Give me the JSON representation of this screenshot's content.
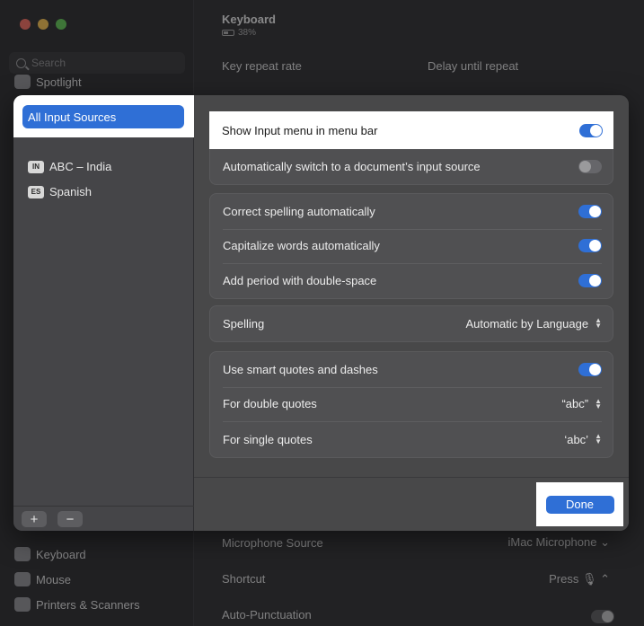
{
  "background": {
    "search_placeholder": "Search",
    "sidebar_items": [
      {
        "label": "Spotlight",
        "icon": "spotlight-icon"
      },
      {
        "label": "Keyboard",
        "icon": "keyboard-icon"
      },
      {
        "label": "Mouse",
        "icon": "mouse-icon"
      },
      {
        "label": "Printers & Scanners",
        "icon": "printer-icon"
      }
    ],
    "title": "Keyboard",
    "battery": "38%",
    "key_repeat_label": "Key repeat rate",
    "delay_label": "Delay until repeat",
    "microphone_label": "Microphone Source",
    "microphone_value": "iMac Microphone",
    "shortcut_label": "Shortcut",
    "shortcut_value": "Press",
    "auto_punct_label": "Auto-Punctuation"
  },
  "sheet": {
    "sidebar": {
      "all_sources": "All Input Sources",
      "sources": [
        {
          "badge": "IN",
          "label": "ABC – India"
        },
        {
          "badge": "ES",
          "label": "Spanish"
        }
      ],
      "add_label": "+",
      "remove_label": "−"
    },
    "main": {
      "show_menu": {
        "label": "Show Input menu in menu bar",
        "on": true
      },
      "auto_switch": {
        "label": "Automatically switch to a document’s input source",
        "on": false
      },
      "correct_spelling": {
        "label": "Correct spelling automatically",
        "on": true
      },
      "capitalize": {
        "label": "Capitalize words automatically",
        "on": true
      },
      "period": {
        "label": "Add period with double-space",
        "on": true
      },
      "spelling": {
        "label": "Spelling",
        "value": "Automatic by Language"
      },
      "smart_quotes": {
        "label": "Use smart quotes and dashes",
        "on": true
      },
      "double_quotes": {
        "label": "For double quotes",
        "value": "“abc”"
      },
      "single_quotes": {
        "label": "For single quotes",
        "value": "‘abc’"
      }
    },
    "done_label": "Done"
  },
  "colors": {
    "accent": "#2f6fd6"
  }
}
